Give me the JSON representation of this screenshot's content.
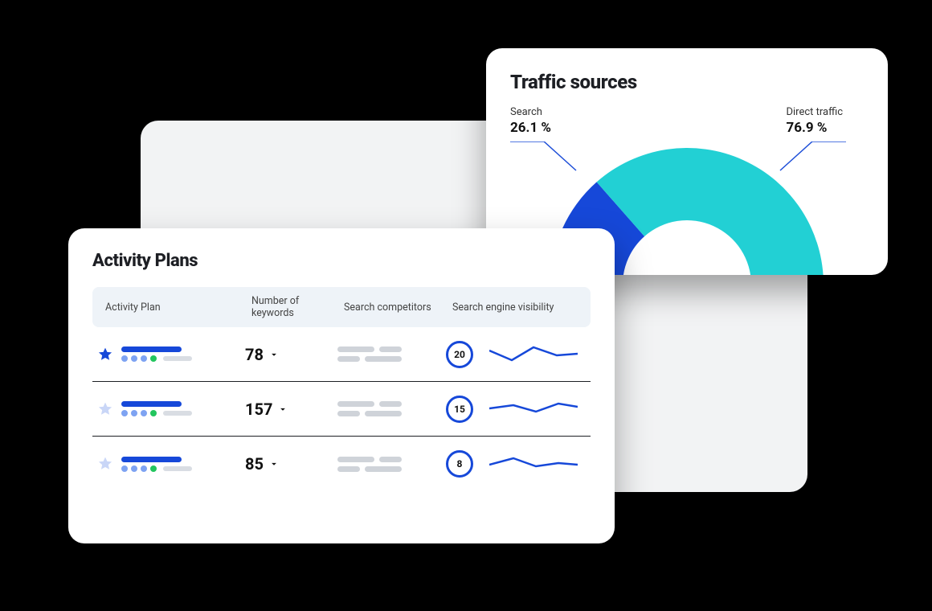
{
  "traffic": {
    "title": "Traffic sources",
    "segments": [
      {
        "name": "Search",
        "value": "26.1 %",
        "pct": 26.1,
        "color": "#1648d9"
      },
      {
        "name": "Direct traffic",
        "value": "76.9 %",
        "pct": 76.9,
        "color": "#22d0d4"
      }
    ]
  },
  "plans": {
    "title": "Activity Plans",
    "columns": {
      "plan": "Activity Plan",
      "keywords": "Number of keywords",
      "competitors": "Search competitors",
      "visibility": "Search engine visibility"
    },
    "rows": [
      {
        "starred": true,
        "keywords": 78,
        "visibility": 20
      },
      {
        "starred": false,
        "keywords": 157,
        "visibility": 15
      },
      {
        "starred": false,
        "keywords": 85,
        "visibility": 8
      }
    ]
  },
  "chart_data": {
    "type": "pie",
    "title": "Traffic sources",
    "series": [
      {
        "name": "Search",
        "values": [
          26.1
        ]
      },
      {
        "name": "Direct traffic",
        "values": [
          76.9
        ]
      }
    ]
  }
}
